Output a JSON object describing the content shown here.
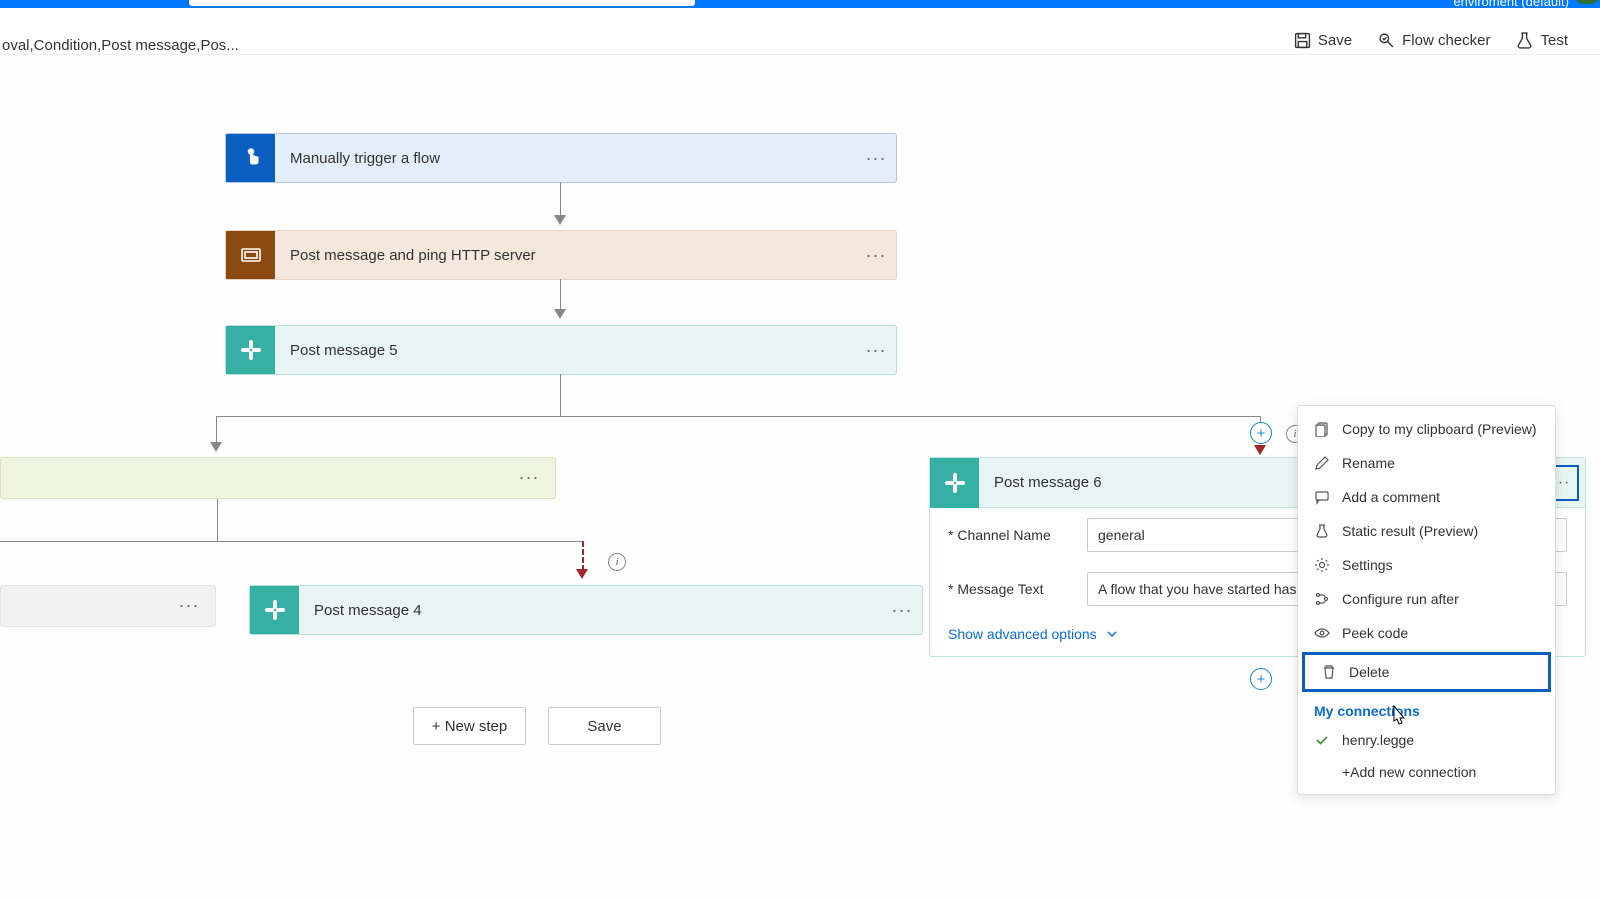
{
  "ribbon": {
    "env_text": "enviroment (default)"
  },
  "breadcrumb": "oval,Condition,Post message,Pos...",
  "toolbar": {
    "save": "Save",
    "checker": "Flow checker",
    "test": "Test"
  },
  "cards": {
    "trigger": "Manually trigger a flow",
    "scope": "Post message and ping HTTP server",
    "pm5": "Post message 5",
    "pm4": "Post message 4",
    "pm6": "Post message 6"
  },
  "pm6_form": {
    "channel_label": "Channel Name",
    "channel_value": "general",
    "message_label": "Message Text",
    "message_value": "A flow that you have started has",
    "advanced": "Show advanced options"
  },
  "ctx": {
    "copy": "Copy to my clipboard (Preview)",
    "rename": "Rename",
    "comment": "Add a comment",
    "static": "Static result (Preview)",
    "settings": "Settings",
    "runafter": "Configure run after",
    "peek": "Peek code",
    "delete": "Delete",
    "my_conn_hdr": "My connections",
    "conn_user": "henry.legge",
    "add_conn": "+Add new connection"
  },
  "bottom": {
    "new_step": "+ New step",
    "save": "Save"
  }
}
